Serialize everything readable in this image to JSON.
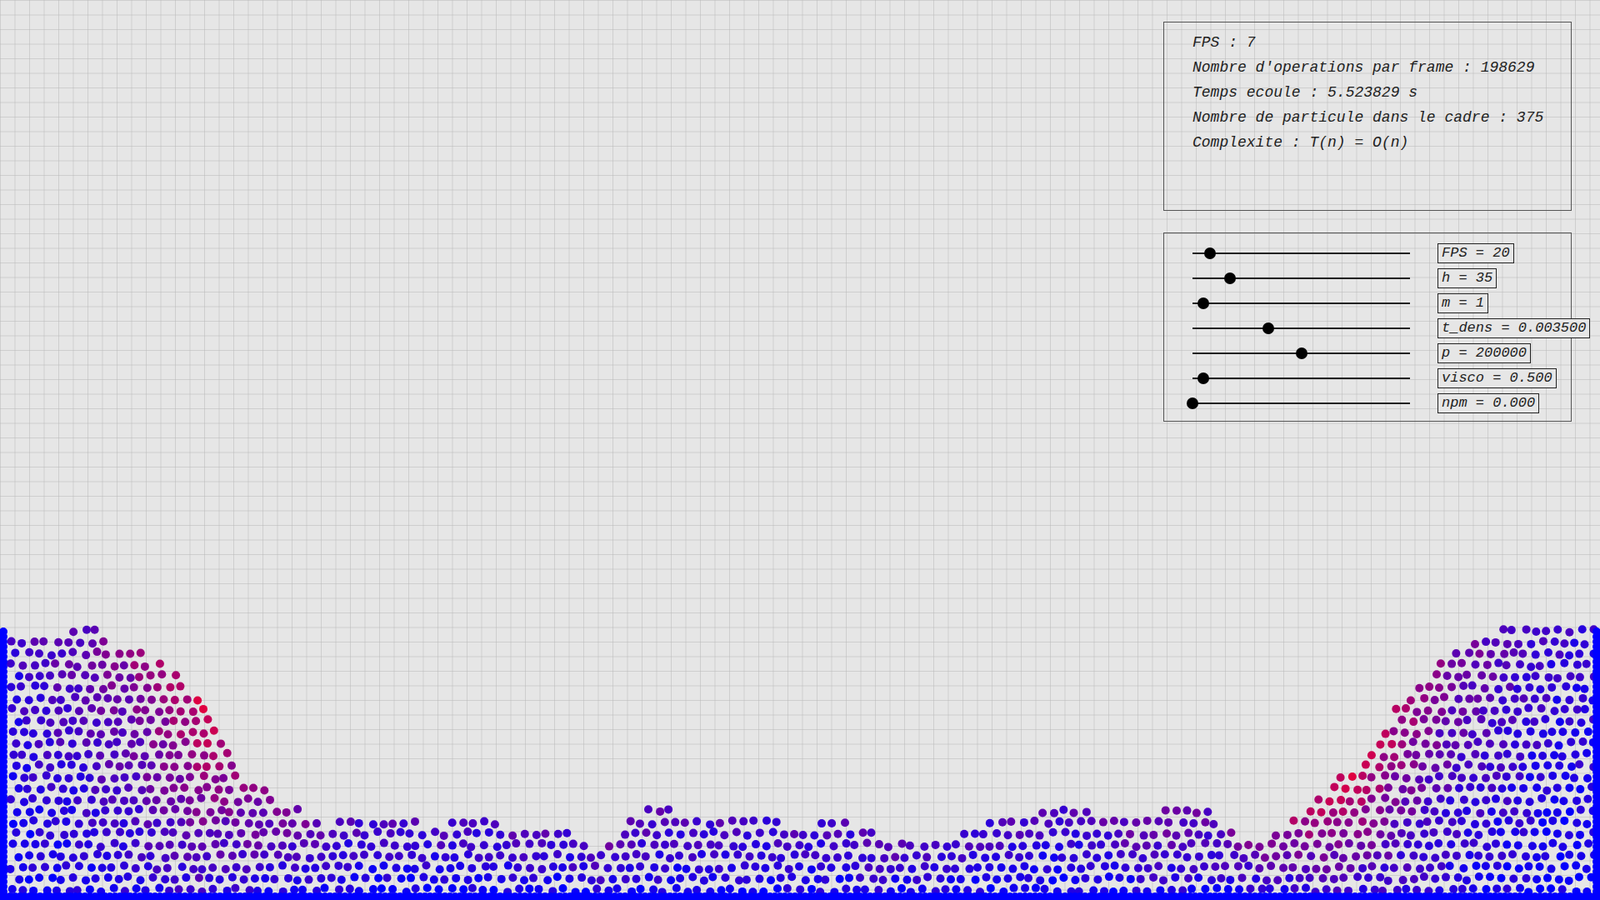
{
  "stats": [
    "FPS : 7",
    "Nombre d'operations par frame : 198629",
    "Temps ecoule : 5.523829 s",
    "Nombre de particule dans le cadre : 375",
    "Complexite : T(n) = O(n)"
  ],
  "sliders": [
    {
      "label": "FPS = 20",
      "level": 0.08
    },
    {
      "label": "h = 35",
      "level": 0.174
    },
    {
      "label": "m = 1",
      "level": 0.05
    },
    {
      "label": "t_dens = 0.003500",
      "level": 0.35
    },
    {
      "label": "p = 200000",
      "level": 0.5
    },
    {
      "label": "visco = 0.500",
      "level": 0.05
    },
    {
      "label": "npm = 0.000",
      "level": 0.0
    }
  ],
  "fluid": {
    "surface_heights": [
      324,
      312,
      331,
      306,
      288,
      245,
      153,
      122,
      92,
      104,
      98,
      92,
      110,
      80,
      86,
      61,
      116,
      104,
      98,
      98,
      92,
      98,
      73,
      67,
      86,
      98,
      110,
      110,
      98,
      110,
      116,
      73,
      86,
      135,
      165,
      245,
      294,
      318,
      333,
      324,
      324
    ],
    "pressure": [
      0.2,
      0.3,
      0.4,
      0.5,
      0.7,
      0.85,
      0.6,
      0.5,
      0.4,
      0.3,
      0.3,
      0.3,
      0.3,
      0.35,
      0.3,
      0.4,
      0.4,
      0.3,
      0.3,
      0.3,
      0.3,
      0.3,
      0.4,
      0.4,
      0.3,
      0.3,
      0.3,
      0.3,
      0.4,
      0.5,
      0.4,
      0.5,
      0.6,
      0.85,
      0.85,
      0.7,
      0.5,
      0.4,
      0.3,
      0.2,
      0.2
    ]
  }
}
